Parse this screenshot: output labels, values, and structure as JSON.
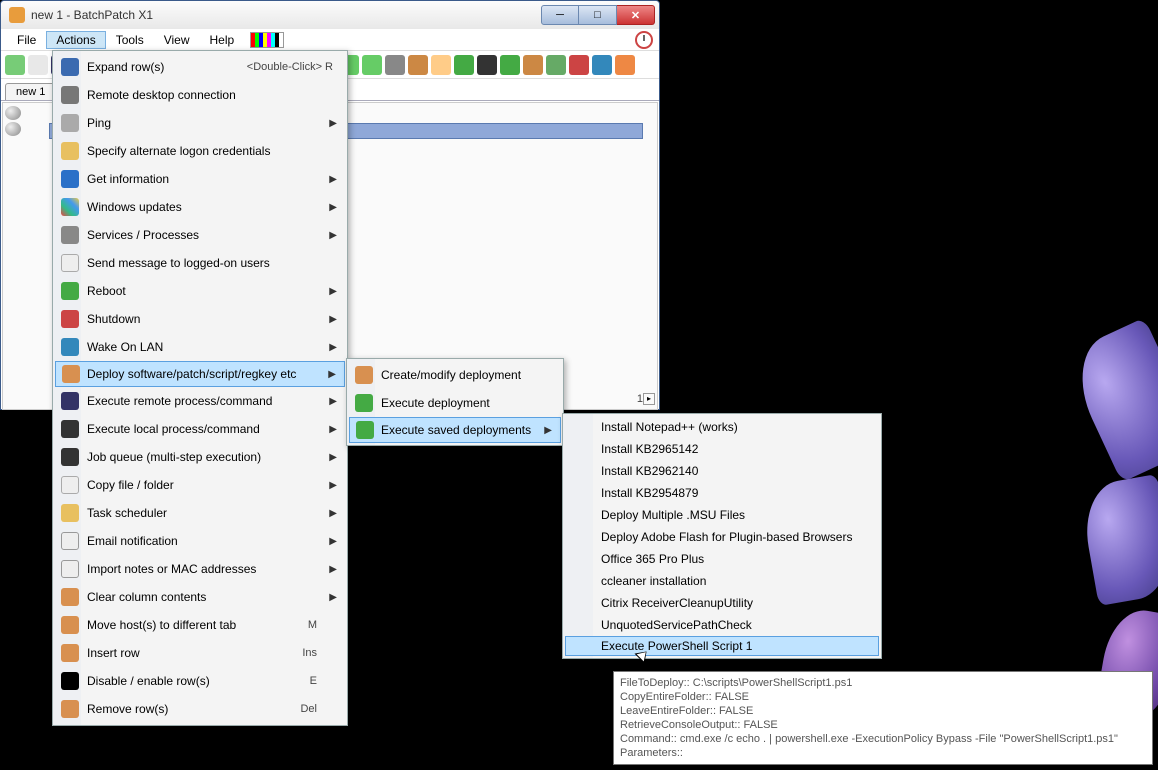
{
  "window": {
    "title": "new 1 - BatchPatch X1"
  },
  "menubar": {
    "items": [
      "File",
      "Actions",
      "Tools",
      "View",
      "Help"
    ],
    "active": 1
  },
  "tabstrip": {
    "tabs": [
      "new 1"
    ]
  },
  "grid": {
    "page": "1"
  },
  "actions_menu": {
    "items": [
      {
        "label": "Expand row(s)",
        "accel": "<Double-Click>  R",
        "icon": "ic-expand"
      },
      {
        "label": "Remote desktop connection",
        "icon": "ic-rdp"
      },
      {
        "label": "Ping",
        "icon": "ic-ping",
        "submenu": true
      },
      {
        "label": "Specify alternate logon credentials",
        "icon": "ic-lock"
      },
      {
        "label": "Get information",
        "icon": "ic-info",
        "submenu": true
      },
      {
        "label": "Windows updates",
        "icon": "ic-wu",
        "submenu": true
      },
      {
        "label": "Services / Processes",
        "icon": "ic-gear",
        "submenu": true
      },
      {
        "label": "Send message to logged-on users",
        "icon": "ic-msg"
      },
      {
        "label": "Reboot",
        "icon": "ic-reboot",
        "submenu": true
      },
      {
        "label": "Shutdown",
        "icon": "ic-shut",
        "submenu": true
      },
      {
        "label": "Wake On LAN",
        "icon": "ic-wol",
        "submenu": true
      },
      {
        "label": "Deploy software/patch/script/regkey etc",
        "icon": "ic-deploy",
        "submenu": true,
        "selected": true
      },
      {
        "label": "Execute remote process/command",
        "icon": "ic-remote",
        "submenu": true
      },
      {
        "label": "Execute local process/command",
        "icon": "ic-local",
        "submenu": true
      },
      {
        "label": "Job queue (multi-step execution)",
        "icon": "ic-queue",
        "submenu": true
      },
      {
        "label": "Copy file / folder",
        "icon": "ic-copy",
        "submenu": true
      },
      {
        "label": "Task scheduler",
        "icon": "ic-sched",
        "submenu": true
      },
      {
        "label": "Email notification",
        "icon": "ic-email",
        "submenu": true
      },
      {
        "label": "Import notes or MAC addresses",
        "icon": "ic-import",
        "submenu": true
      },
      {
        "label": "Clear column contents",
        "icon": "ic-clear",
        "submenu": true
      },
      {
        "label": "Move host(s) to different tab",
        "icon": "ic-move",
        "short": "M"
      },
      {
        "label": "Insert row",
        "icon": "ic-insert",
        "short": "Ins"
      },
      {
        "label": "Disable / enable row(s)",
        "icon": "ic-disable",
        "short": "E"
      },
      {
        "label": "Remove row(s)",
        "icon": "ic-remove",
        "short": "Del"
      }
    ]
  },
  "deploy_menu": {
    "items": [
      {
        "label": "Create/modify deployment",
        "icon": "ic-create"
      },
      {
        "label": "Execute deployment",
        "icon": "ic-exec"
      },
      {
        "label": "Execute saved deployments",
        "icon": "ic-check",
        "submenu": true,
        "selected": true
      }
    ]
  },
  "saved_menu": {
    "items": [
      {
        "label": "Install Notepad++ (works)"
      },
      {
        "label": "Install KB2965142"
      },
      {
        "label": "Install KB2962140"
      },
      {
        "label": "Install KB2954879"
      },
      {
        "label": "Deploy Multiple .MSU Files"
      },
      {
        "label": "Deploy Adobe Flash for Plugin-based Browsers"
      },
      {
        "label": "Office 365 Pro Plus"
      },
      {
        "label": "ccleaner installation"
      },
      {
        "label": "Citrix ReceiverCleanupUtility"
      },
      {
        "label": "UnquotedServicePathCheck"
      },
      {
        "label": "Execute PowerShell Script 1",
        "selected": true
      }
    ]
  },
  "tooltip": {
    "l1": "FileToDeploy:: C:\\scripts\\PowerShellScript1.ps1",
    "l2": "CopyEntireFolder:: FALSE",
    "l3": "LeaveEntireFolder:: FALSE",
    "l4": "RetrieveConsoleOutput:: FALSE",
    "l5": "Command:: cmd.exe /c echo . | powershell.exe -ExecutionPolicy Bypass -File \"PowerShellScript1.ps1\"",
    "l6": "Parameters::"
  }
}
